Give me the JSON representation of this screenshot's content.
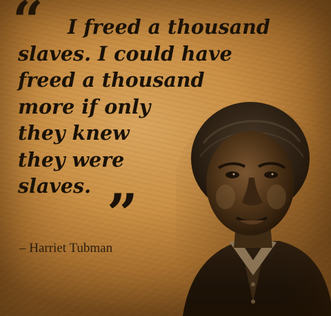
{
  "quote": {
    "open_mark": "“",
    "lines": [
      "I freed a thousand",
      "slaves. I could have",
      "freed a thousand",
      "more if only",
      "they knew",
      "they were",
      "slaves."
    ],
    "close_mark": "”"
  },
  "attribution": "– Harriet Tubman",
  "colors": {
    "background": "#c98f45",
    "text": "#1a1208"
  }
}
